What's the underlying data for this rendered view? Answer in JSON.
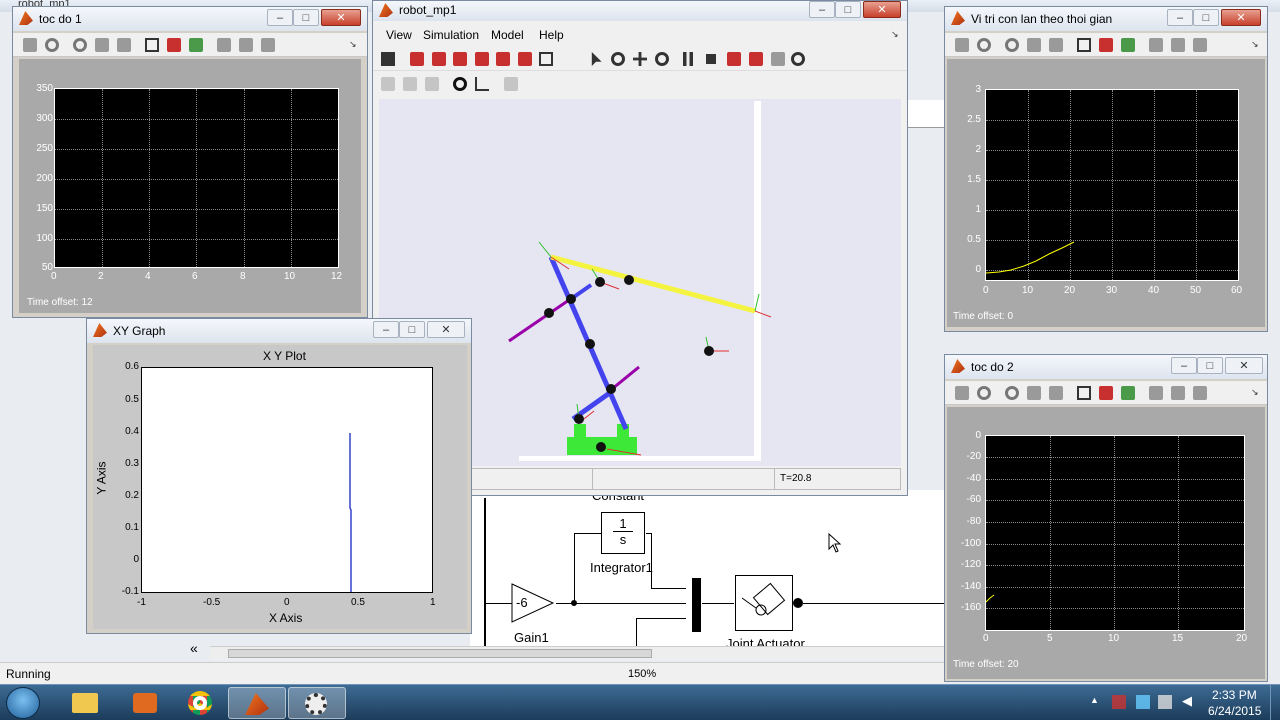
{
  "desktop": {
    "behind_title": "robot_mp1",
    "status": "Running",
    "zoom": "150%"
  },
  "model": {
    "blocks": {
      "constant_label": "Constant",
      "integrator_num": "1",
      "integrator_den": "s",
      "integrator_label": "Integrator1",
      "gain_value": "-6",
      "gain_label": "Gain1",
      "actuator_label": "Joint Actuator"
    }
  },
  "scope1": {
    "title": "toc do 1",
    "yticks": [
      "350",
      "300",
      "250",
      "200",
      "150",
      "100",
      "50"
    ],
    "xticks": [
      "0",
      "2",
      "4",
      "6",
      "8",
      "10",
      "12"
    ],
    "time_offset": "Time offset:  12"
  },
  "robot": {
    "title": "robot_mp1",
    "menu": [
      "View",
      "Simulation",
      "Model",
      "Help"
    ],
    "time": "T=20.8"
  },
  "scope3": {
    "title": "Vi tri con lan  theo thoi gian",
    "yticks": [
      "3",
      "2.5",
      "2",
      "1.5",
      "1",
      "0.5",
      "0"
    ],
    "xticks": [
      "0",
      "10",
      "20",
      "30",
      "40",
      "50",
      "60"
    ],
    "time_offset": "Time offset:  0"
  },
  "xy": {
    "title": "XY Graph",
    "plot_title": "X Y Plot",
    "xlabel": "X Axis",
    "ylabel": "Y Axis",
    "yticks": [
      "0.6",
      "0.5",
      "0.4",
      "0.3",
      "0.2",
      "0.1",
      "0",
      "-0.1"
    ],
    "xticks": [
      "-1",
      "-0.5",
      "0",
      "0.5",
      "1"
    ]
  },
  "scope2": {
    "title": "toc do 2",
    "yticks": [
      "0",
      "-20",
      "-40",
      "-60",
      "-80",
      "-100",
      "-120",
      "-140",
      "-160"
    ],
    "xticks": [
      "0",
      "5",
      "10",
      "15",
      "20"
    ],
    "time_offset": "Time offset:  20"
  },
  "taskbar": {
    "time": "2:33 PM",
    "date": "6/24/2015"
  },
  "chart_data": [
    {
      "type": "line",
      "title": "toc do 1",
      "xlim": [
        0,
        12
      ],
      "ylim": [
        50,
        350
      ],
      "series": []
    },
    {
      "type": "line",
      "title": "Vi tri con lan  theo thoi gian",
      "xlim": [
        0,
        60
      ],
      "ylim": [
        -0.2,
        3
      ],
      "series": [
        {
          "color": "#ffff00",
          "x": [
            0,
            3,
            6,
            9,
            12,
            15,
            18,
            21
          ],
          "y": [
            -0.1,
            -0.08,
            -0.04,
            0.02,
            0.1,
            0.2,
            0.3,
            0.4
          ]
        }
      ]
    },
    {
      "type": "line",
      "title": "X Y Plot",
      "xlabel": "X Axis",
      "ylabel": "Y Axis",
      "xlim": [
        -1,
        1
      ],
      "ylim": [
        -0.1,
        0.6
      ],
      "series": [
        {
          "color": "#3344cc",
          "x": [
            0.43,
            0.43,
            0.44,
            0.44
          ],
          "y": [
            0.4,
            0.17,
            0.16,
            -0.1
          ]
        }
      ]
    },
    {
      "type": "line",
      "title": "toc do 2",
      "xlim": [
        0,
        20
      ],
      "ylim": [
        -170,
        0
      ],
      "series": [
        {
          "color": "#ffff00",
          "x": [
            0,
            0.3,
            0.6
          ],
          "y": [
            -150,
            -147,
            -144
          ]
        }
      ]
    }
  ]
}
